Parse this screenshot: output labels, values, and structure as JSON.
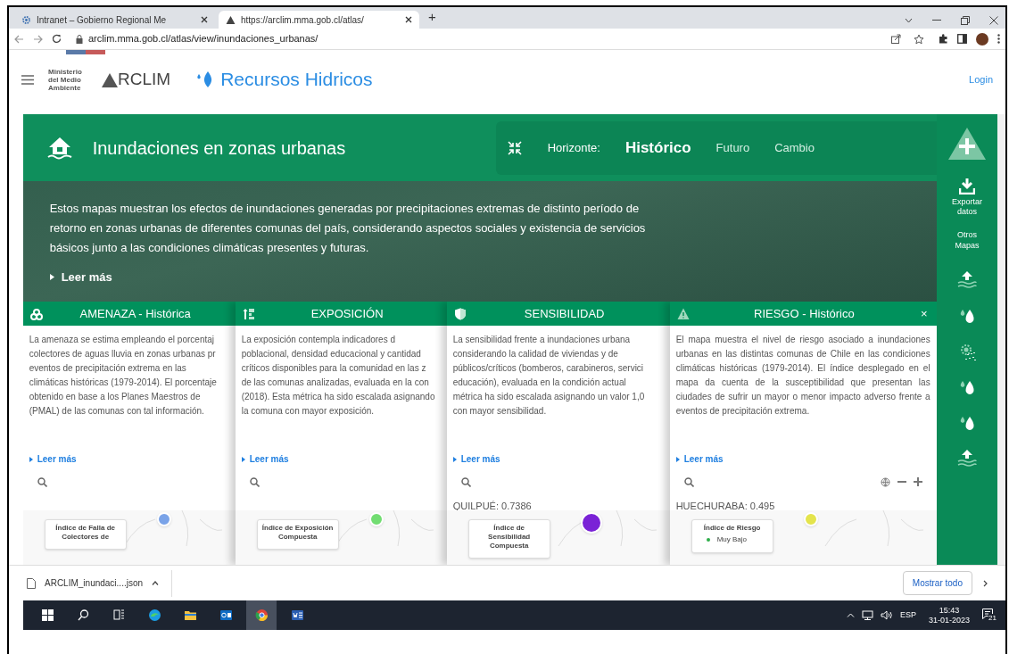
{
  "browser": {
    "tabs": [
      {
        "title": "Intranet – Gobierno Regional Me",
        "selected": false
      },
      {
        "title": "https://arclim.mma.gob.cl/atlas/",
        "selected": true
      }
    ],
    "new_tab": "+",
    "url": "arclim.mma.gob.cl/atlas/view/inundaciones_urbanas/"
  },
  "site_header": {
    "ministry": "Ministerio del Medio Ambiente",
    "logo": "RCLIM",
    "section": "Recursos Hidricos",
    "login": "Login"
  },
  "banner": {
    "title": "Inundaciones en zonas urbanas",
    "horizon_label": "Horizonte:",
    "horizons": [
      {
        "label": "Histórico",
        "selected": true
      },
      {
        "label": "Futuro",
        "selected": false
      },
      {
        "label": "Cambio",
        "selected": false
      }
    ],
    "description": "Estos mapas muestran los efectos de inundaciones generadas por precipitaciones extremas de distinto período de retorno en zonas urbanas de diferentes comunas del país, considerando aspectos sociales y existencia de servicios básicos junto a las condiciones climáticas presentes y futuras.",
    "read_more": "Leer más"
  },
  "sidebar": {
    "export": "Exportar datos",
    "other_maps": "Otros Mapas",
    "layers": [
      {
        "kind": "flood"
      },
      {
        "kind": "drops"
      },
      {
        "kind": "sun-rain"
      },
      {
        "kind": "drops"
      },
      {
        "kind": "drops"
      },
      {
        "kind": "flood"
      }
    ]
  },
  "cards": [
    {
      "kind": "hazard",
      "title": "AMENAZA - Histórica",
      "lines": [
        "La amenaza se estima empleando el porcentaj",
        "colectores de aguas lluvia en zonas urbanas pr",
        "eventos de precipitación extrema en las",
        "climáticas históricas (1979-2014). El porcentaje",
        "obtenido en base a los Planes Maestros de",
        "(PMAL) de las comunas con tal información."
      ],
      "read_more": "Leer más",
      "legend_title": "Índice de Falla de Colectores de",
      "color": "#7aa3e8"
    },
    {
      "kind": "exposure",
      "title": "EXPOSICIÓN",
      "lines": [
        "La exposición contempla indicadores d",
        "poblacional, densidad educacional y cantidad",
        "críticos disponibles para la comunidad en las z",
        "de las comunas analizadas, evaluada en la con",
        "(2018). Esta métrica ha sido escalada asignando",
        "la comuna con mayor exposición."
      ],
      "read_more": "Leer más",
      "legend_title": "Índice de Exposición Compuesta",
      "color": "#72dd72"
    },
    {
      "kind": "sensitivity",
      "title": "SENSIBILIDAD",
      "lines": [
        "La sensibilidad frente a inundaciones urbana",
        "considerando la calidad de viviendas y de",
        "públicos/críticos (bomberos, carabineros, servici",
        "educación), evaluada en la condición actual",
        "métrica ha sido escalada asignando un valor 1,0",
        "con mayor sensibilidad."
      ],
      "read_more": "Leer más",
      "value": "QUILPUÉ: 0.7386",
      "legend_title": "Índice de Sensibilidad Compuesta",
      "color": "#7a22d6"
    },
    {
      "kind": "risk",
      "title": "RIESGO - Histórico",
      "closable": true,
      "close": "×",
      "lines": [
        "El mapa muestra el nivel de riesgo asociado a inundaciones urbanas en las distintas comunas de Chile en las condiciones climáticas históricas (1979-2014). El índice desplegado en el mapa da cuenta de la susceptibilidad que presentan las ciudades de sufrir un mayor o menor impacto adverso frente a eventos de precipitación extrema."
      ],
      "read_more": "Leer más",
      "value": "HUECHURABA: 0.495",
      "map_controls": true,
      "legend_title": "Índice de Riesgo",
      "legend_items": [
        {
          "label": "Muy Bajo",
          "color": "#2fae4a"
        }
      ],
      "color": "#e4e44c"
    }
  ],
  "downloads": {
    "file": "ARCLIM_inundaci....json",
    "show_all": "Mostrar todo"
  },
  "taskbar": {
    "apps": [
      {
        "kind": "start",
        "active": false
      },
      {
        "kind": "search",
        "active": false
      },
      {
        "kind": "taskview",
        "active": false
      },
      {
        "kind": "edge",
        "active": false
      },
      {
        "kind": "explorer",
        "active": false
      },
      {
        "kind": "outlook",
        "active": false
      },
      {
        "kind": "chrome",
        "active": true
      },
      {
        "kind": "word",
        "active": false
      }
    ],
    "language": "ESP",
    "time": "15:43",
    "date": "31-01-2023",
    "notifications": "21"
  }
}
